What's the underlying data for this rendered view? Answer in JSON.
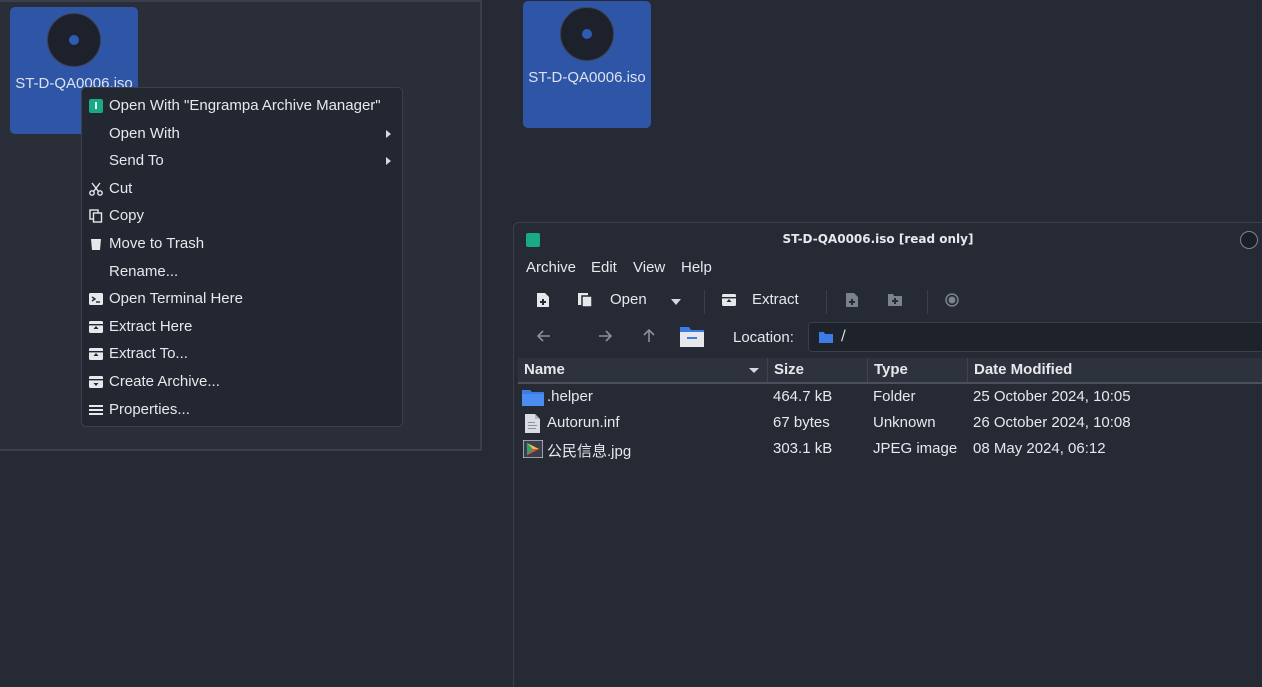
{
  "desktop": {
    "icon_left_label": "ST-D-QA0006.iso",
    "icon_right_label": "ST-D-QA0006.iso"
  },
  "context_menu": {
    "items": [
      {
        "label": "Open With \"Engrampa Archive Manager\"",
        "icon": "engrampa-app-icon"
      },
      {
        "label": "Open With",
        "icon": "",
        "submenu": true
      },
      {
        "label": "Send To",
        "icon": "",
        "submenu": true
      },
      {
        "label": "Cut",
        "icon": "scissors-icon"
      },
      {
        "label": "Copy",
        "icon": "copy-icon"
      },
      {
        "label": "Move to Trash",
        "icon": "trash-icon"
      },
      {
        "label": "Rename...",
        "icon": ""
      },
      {
        "label": "Open Terminal Here",
        "icon": "terminal-icon"
      },
      {
        "label": "Extract Here",
        "icon": "extract-icon"
      },
      {
        "label": "Extract To...",
        "icon": "extract-icon"
      },
      {
        "label": "Create Archive...",
        "icon": "archive-icon"
      },
      {
        "label": "Properties...",
        "icon": "properties-icon"
      }
    ]
  },
  "window": {
    "title": "ST-D-QA0006.iso [read only]",
    "menu": [
      "Archive",
      "Edit",
      "View",
      "Help"
    ],
    "toolbar": {
      "open_label": "Open",
      "extract_label": "Extract"
    },
    "location_label": "Location:",
    "location_path": "/",
    "columns": [
      "Name",
      "Size",
      "Type",
      "Date Modified"
    ],
    "files": [
      {
        "name": ".helper",
        "size": "464.7 kB",
        "type": "Folder",
        "date": "25 October 2024, 10:05",
        "icon": "folder-icon"
      },
      {
        "name": "Autorun.inf",
        "size": "67 bytes",
        "type": "Unknown",
        "date": "26 October 2024, 10:08",
        "icon": "text-file-icon"
      },
      {
        "name": "公民信息.jpg",
        "size": "303.1 kB",
        "type": "JPEG image",
        "date": "08 May 2024, 06:12",
        "icon": "image-file-icon"
      }
    ]
  },
  "colors": {
    "desktop_bg": "#262a35",
    "icon_selected": "#2f55a6",
    "accent_folder": "#3d7ce6",
    "app_green": "#1aa985"
  }
}
